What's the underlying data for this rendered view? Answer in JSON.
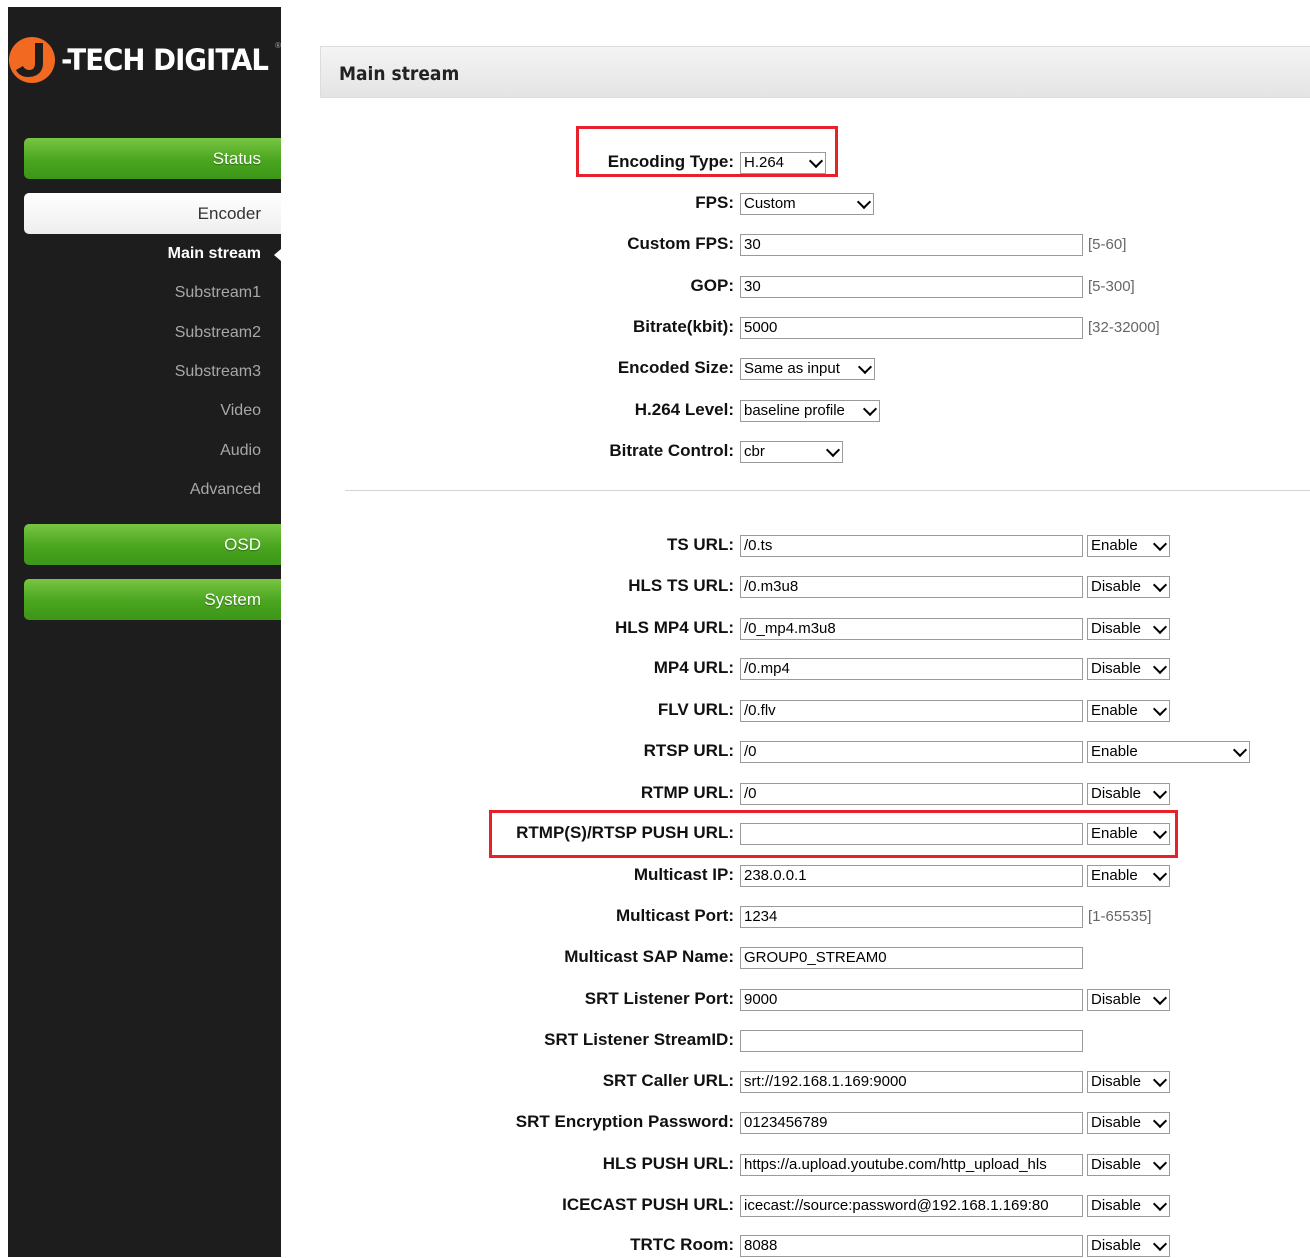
{
  "brand": {
    "logo_text": "-TECH DIGITAL",
    "registered_mark": "®",
    "logo_accent_color": "#f26a21"
  },
  "nav": {
    "status": "Status",
    "encoder": "Encoder",
    "encoder_subitems": [
      "Main stream",
      "Substream1",
      "Substream2",
      "Substream3",
      "Video",
      "Audio",
      "Advanced"
    ],
    "active_subitem": "Main stream",
    "osd": "OSD",
    "system": "System",
    "nav_color": "#4aa51f"
  },
  "panel": {
    "title": "Main stream"
  },
  "encoding": {
    "encoding_type": {
      "label": "Encoding Type:",
      "value": "H.264"
    },
    "fps": {
      "label": "FPS:",
      "value": "Custom"
    },
    "custom_fps": {
      "label": "Custom FPS:",
      "value": "30",
      "range": "[5-60]"
    },
    "gop": {
      "label": "GOP:",
      "value": "30",
      "range": "[5-300]"
    },
    "bitrate": {
      "label": "Bitrate(kbit):",
      "value": "5000",
      "range": "[32-32000]"
    },
    "encoded_size": {
      "label": "Encoded Size:",
      "value": "Same as input"
    },
    "h264_level": {
      "label": "H.264 Level:",
      "value": "baseline profile"
    },
    "bitrate_control": {
      "label": "Bitrate Control:",
      "value": "cbr"
    }
  },
  "streams": {
    "ts_url": {
      "label": "TS URL:",
      "value": "/0.ts",
      "state": "Enable"
    },
    "hls_ts_url": {
      "label": "HLS TS URL:",
      "value": "/0.m3u8",
      "state": "Disable"
    },
    "hls_mp4_url": {
      "label": "HLS MP4 URL:",
      "value": "/0_mp4.m3u8",
      "state": "Disable"
    },
    "mp4_url": {
      "label": "MP4 URL:",
      "value": "/0.mp4",
      "state": "Disable"
    },
    "flv_url": {
      "label": "FLV URL:",
      "value": "/0.flv",
      "state": "Enable"
    },
    "rtsp_url": {
      "label": "RTSP URL:",
      "value": "/0",
      "state": "Enable"
    },
    "rtmp_url": {
      "label": "RTMP URL:",
      "value": "/0",
      "state": "Disable"
    },
    "push_url": {
      "label": "RTMP(S)/RTSP PUSH URL:",
      "value": "",
      "state": "Enable"
    },
    "multicast_ip": {
      "label": "Multicast IP:",
      "value": "238.0.0.1",
      "state": "Enable"
    },
    "multicast_port": {
      "label": "Multicast Port:",
      "value": "1234",
      "range": "[1-65535]"
    },
    "multicast_sap": {
      "label": "Multicast SAP Name:",
      "value": "GROUP0_STREAM0"
    },
    "srt_listener_port": {
      "label": "SRT Listener Port:",
      "value": "9000",
      "state": "Disable"
    },
    "srt_listener_streamid": {
      "label": "SRT Listener StreamID:",
      "value": ""
    },
    "srt_caller_url": {
      "label": "SRT Caller URL:",
      "value": "srt://192.168.1.169:9000",
      "state": "Disable"
    },
    "srt_password": {
      "label": "SRT Encryption Password:",
      "value": "0123456789",
      "state": "Disable"
    },
    "hls_push_url": {
      "label": "HLS PUSH URL:",
      "value": "https://a.upload.youtube.com/http_upload_hls",
      "state": "Disable"
    },
    "icecast_push_url": {
      "label": "ICECAST PUSH URL:",
      "value": "icecast://source:password@192.168.1.169:80",
      "state": "Disable"
    },
    "trtc_room": {
      "label": "TRTC Room:",
      "value": "8088",
      "state": "Disable"
    }
  },
  "highlight_color": "#e8202a"
}
